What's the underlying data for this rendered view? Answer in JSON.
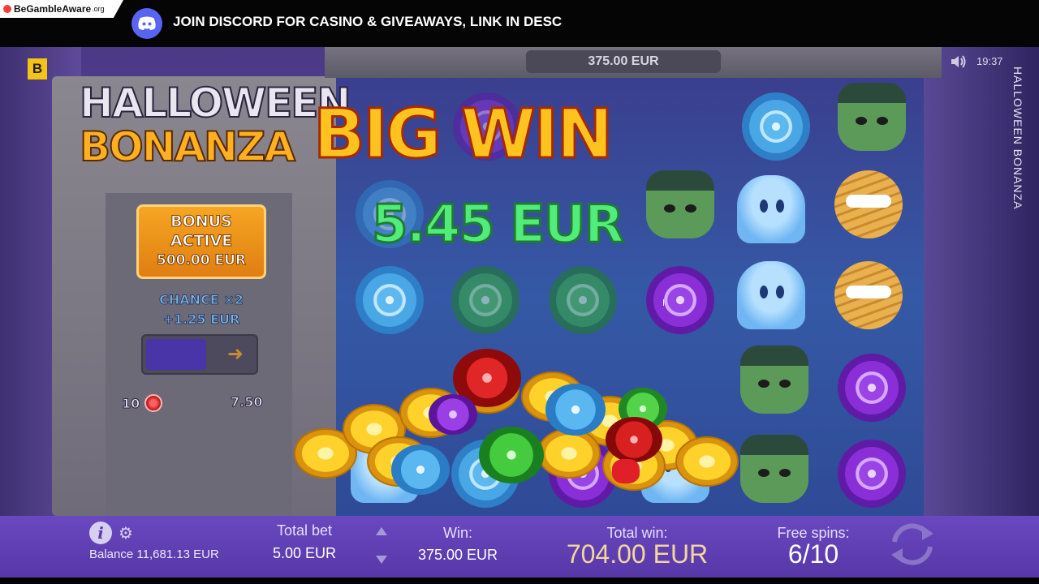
{
  "banner": {
    "gamble_brand": "BeGambleAware",
    "gamble_suffix": ".org",
    "text": "JOIN DISCORD FOR CASINO & GIVEAWAYS, LINK IN DESC"
  },
  "game": {
    "corner_logo": "B",
    "title_line1": "HALLOWEEN",
    "title_line2": "BONANZA",
    "side_title": "HALLOWEEN BONANZA",
    "stake_display": "375.00 EUR",
    "clock": "19:37",
    "bonus": {
      "line1": "BONUS",
      "line2": "ACTIVE",
      "amount": "500.00 EUR"
    },
    "chance": {
      "line1": "CHANCE ×2",
      "line2": "+1.25 EUR"
    },
    "spins_left": "10",
    "spins_cost": "7.50",
    "overlay": {
      "headline": "BIG WIN",
      "amount": "5.45 EUR"
    },
    "icons": [
      "begambleaware-dot-icon",
      "discord-icon",
      "speaker-icon",
      "info-icon",
      "gear-icon",
      "spin-icon",
      "arrow-right-icon"
    ]
  },
  "bottom_bar": {
    "balance_label": "Balance",
    "balance_value": "11,681.13 EUR",
    "total_bet_label": "Total bet",
    "total_bet_value": "5.00 EUR",
    "win_label": "Win:",
    "win_value": "375.00 EUR",
    "total_win_label": "Total win:",
    "total_win_value": "704.00 EUR",
    "free_spins_label": "Free spins:",
    "free_spins_value": "6/10"
  }
}
